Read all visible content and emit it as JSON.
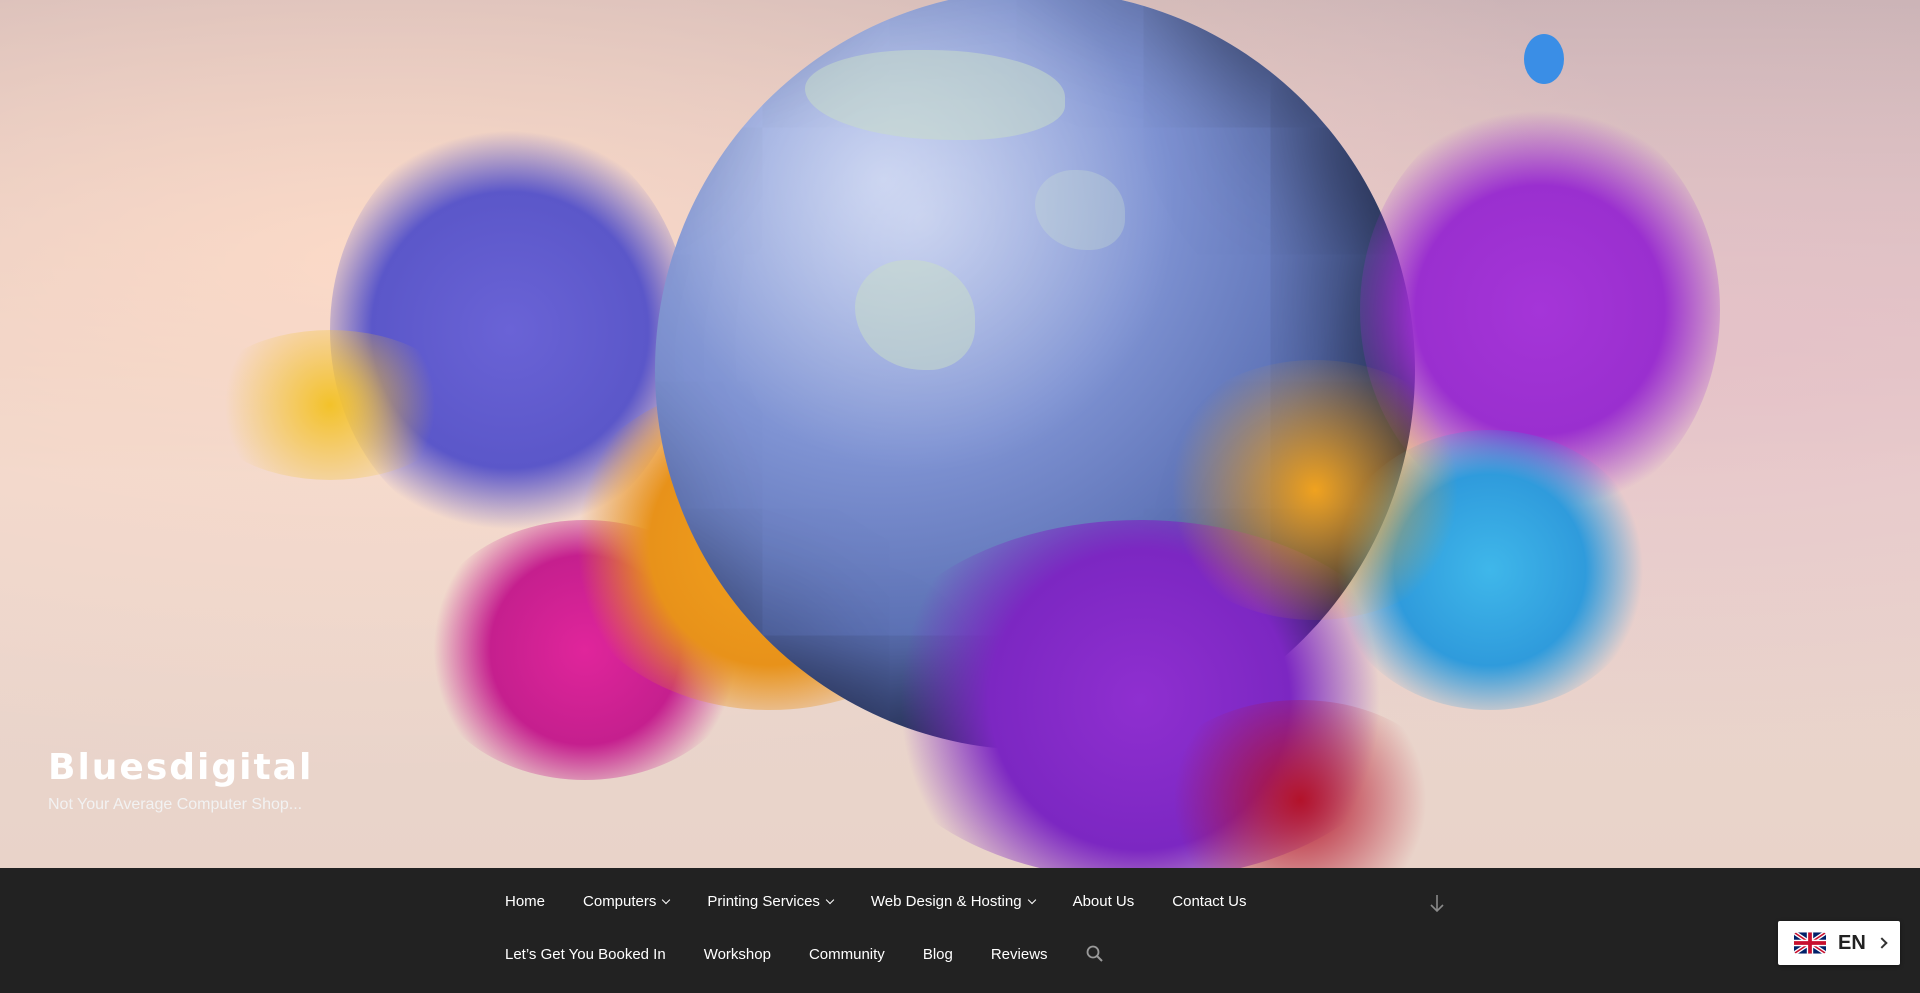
{
  "site": {
    "title": "Bluesdigital",
    "tagline": "Not Your Average Computer Shop..."
  },
  "nav": {
    "row1": [
      {
        "label": "Home",
        "dropdown": false
      },
      {
        "label": "Computers",
        "dropdown": true
      },
      {
        "label": "Printing Services",
        "dropdown": true
      },
      {
        "label": "Web Design & Hosting",
        "dropdown": true
      },
      {
        "label": "About Us",
        "dropdown": false
      },
      {
        "label": "Contact Us",
        "dropdown": false
      }
    ],
    "row2": [
      {
        "label": "Let’s Get You Booked In",
        "dropdown": false
      },
      {
        "label": "Workshop",
        "dropdown": false
      },
      {
        "label": "Community",
        "dropdown": false
      },
      {
        "label": "Blog",
        "dropdown": false
      },
      {
        "label": "Reviews",
        "dropdown": false
      }
    ],
    "icons": {
      "search": "search-icon",
      "scroll": "arrow-down-icon"
    }
  },
  "language": {
    "code": "EN",
    "flag": "uk-flag-icon"
  },
  "colors": {
    "nav_background": "#222222",
    "nav_text": "#ffffff",
    "language_box": "#ffffff"
  }
}
